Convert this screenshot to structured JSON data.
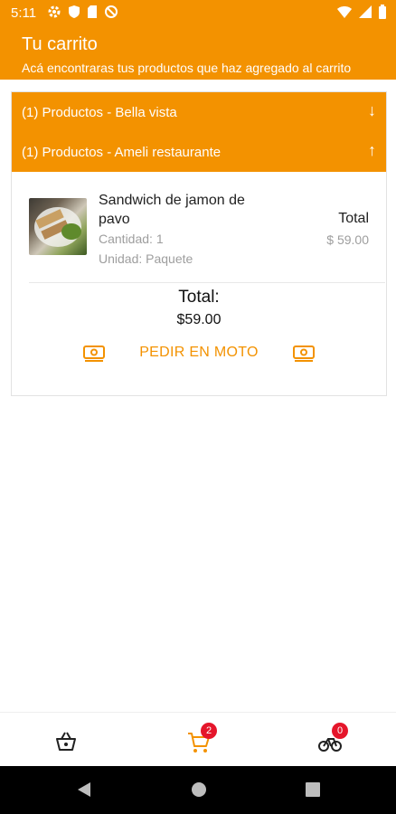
{
  "status_bar": {
    "time": "5:11"
  },
  "header": {
    "title": "Tu carrito",
    "subtitle": "Acá encontraras tus productos que haz agregado al carrito"
  },
  "groups": [
    {
      "label": "(1) Productos - Bella vista",
      "arrow": "↓"
    },
    {
      "label": "(1) Productos - Ameli restaurante",
      "arrow": "↑"
    }
  ],
  "item": {
    "name": "Sandwich de jamon de pavo",
    "quantity": "Cantidad: 1",
    "unit": "Unidad: Paquete",
    "total_label": "Total",
    "price": "$ 59.00"
  },
  "summary": {
    "total_label": "Total:",
    "total_value": "$59.00",
    "order_button": "PEDIR EN MOTO"
  },
  "bottom_nav": {
    "cart_badge": "2",
    "moto_badge": "0"
  },
  "colors": {
    "accent": "#F39200",
    "badge": "#E5162B"
  }
}
